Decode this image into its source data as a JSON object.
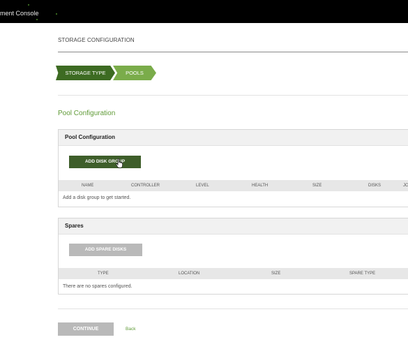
{
  "topbar": {
    "title": "ment Console"
  },
  "page": {
    "heading": "STORAGE CONFIGURATION"
  },
  "steps": [
    {
      "label": "STORAGE TYPE",
      "state": "complete",
      "color": "#3d6b22"
    },
    {
      "label": "POOLS",
      "state": "active",
      "color": "#7aac4a"
    }
  ],
  "section_title": "Pool Configuration",
  "pool_panel": {
    "title": "Pool Configuration",
    "add_button": "ADD DISK GROUP",
    "columns": [
      "NAME",
      "CONTROLLER",
      "LEVEL",
      "HEALTH",
      "SIZE",
      "DISKS",
      "JC"
    ],
    "empty_message": "Add a disk group to get started."
  },
  "spares_panel": {
    "title": "Spares",
    "add_button": "ADD SPARE DISKS",
    "columns": [
      "TYPE",
      "LOCATION",
      "SIZE",
      "SPARE TYPE"
    ],
    "empty_message": "There are no spares configured."
  },
  "footer": {
    "continue_label": "CONTINUE",
    "back_label": "Back"
  },
  "colors": {
    "accent": "#5f9a36",
    "dark_green": "#3e5e2a",
    "disabled": "#b9b9b9"
  },
  "icons": {
    "cursor": "hand-pointer-icon"
  }
}
